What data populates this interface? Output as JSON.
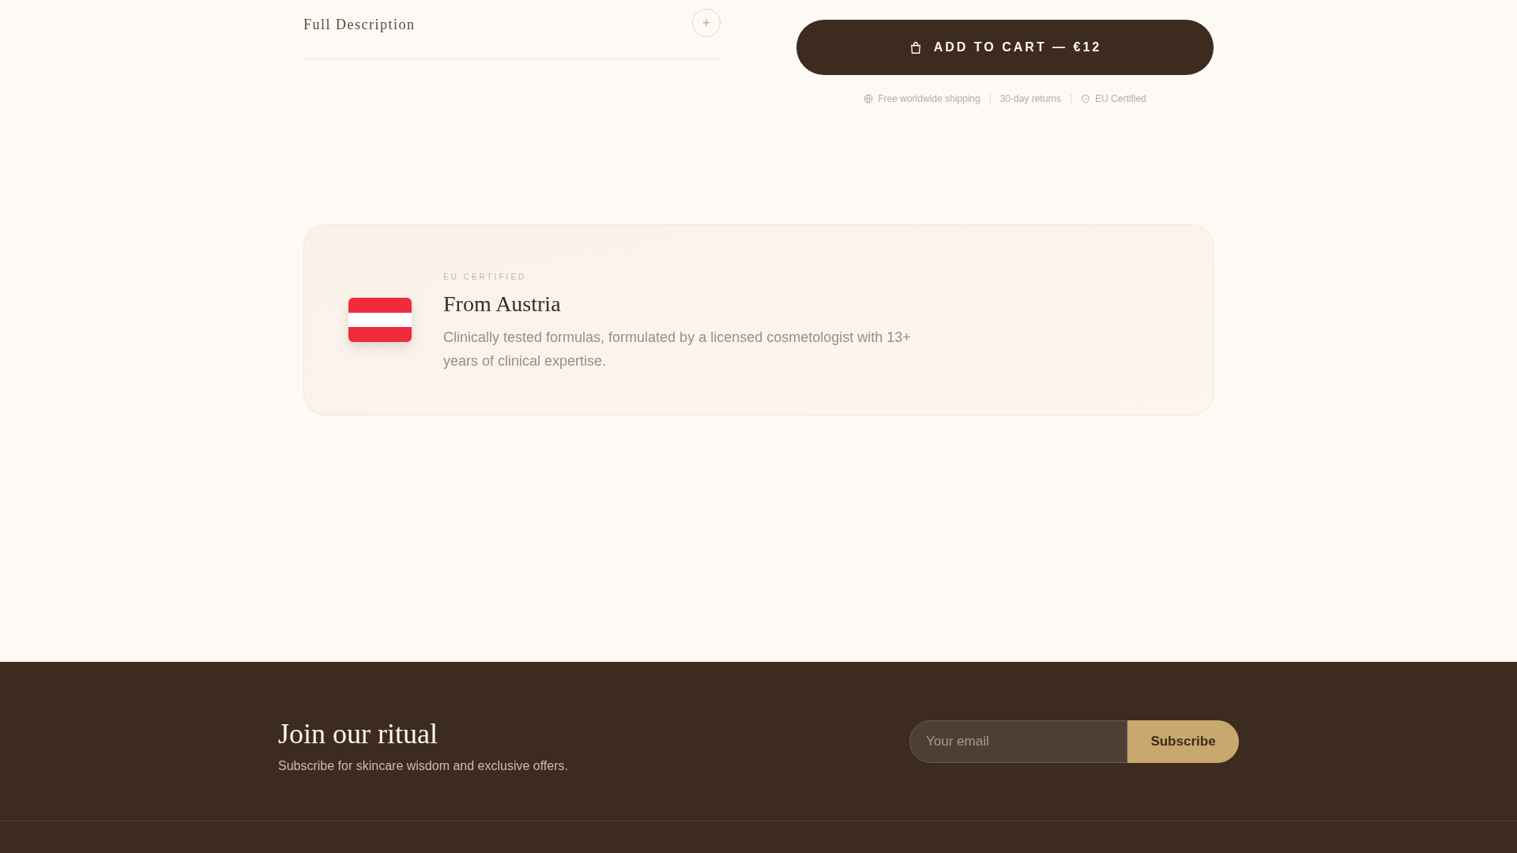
{
  "accordion": {
    "title": "Full Description",
    "toggle": "+",
    "expanded": false
  },
  "cart_button": {
    "label": "ADD TO CART — €12"
  },
  "trust_items": [
    {
      "kind": "globe",
      "label": "Free worldwide shipping"
    },
    {
      "kind": "none",
      "label": "30-day returns"
    },
    {
      "kind": "shield",
      "label": "EU Certified"
    }
  ],
  "origin_card": {
    "eyebrow": "EU CERTIFIED",
    "title": "From Austria",
    "description": "Clinically tested formulas, formulated by a licensed cosmetologist with 13+ years of clinical expertise."
  },
  "newsletter": {
    "title": "Join our ritual",
    "subtitle": "Subscribe for skincare wisdom and exclusive offers.",
    "email": {
      "placeholder": "Your email"
    },
    "button": "Subscribe"
  }
}
